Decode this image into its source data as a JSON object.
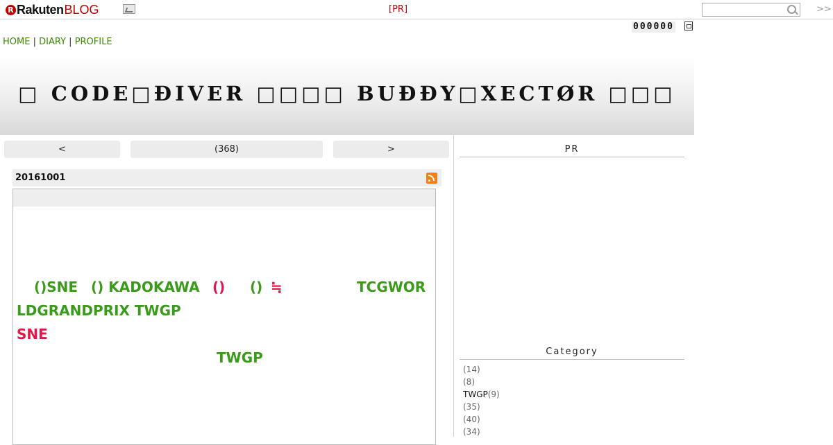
{
  "topbar": {
    "logo_text": "Rakuten",
    "logo_blog": "BLOG",
    "pr": "[PR]",
    "search": {
      "placeholder": ""
    },
    "more": ">>"
  },
  "counter": {
    "value": "000000"
  },
  "nav": {
    "home": "HOME",
    "diary": "DIARY",
    "profile": "PROFILE",
    "sep": "|"
  },
  "banner": {
    "title": "□ CODE□ĐIVER □□□□ BUĐĐY□XECTØR □□□"
  },
  "pager": {
    "prev": "<",
    "count": "(368)",
    "next": ">"
  },
  "entry": {
    "date": "20161001",
    "lines": [
      [
        "()SNE",
        "() KADOKAWA",
        "()",
        "()",
        "≒",
        "TCGWOR"
      ],
      [
        "LDGRANDPRIX TWGP"
      ],
      [
        "SNE"
      ],
      [
        "TWGP"
      ]
    ]
  },
  "sidebar": {
    "pr_heading": "PR",
    "category_heading": "Category",
    "categories": [
      {
        "name": "",
        "count": "(14)"
      },
      {
        "name": "",
        "count": "(8)"
      },
      {
        "name": "TWGP",
        "count": "(9)"
      },
      {
        "name": "",
        "count": "(35)"
      },
      {
        "name": "",
        "count": "(40)"
      },
      {
        "name": "",
        "count": "(34)"
      }
    ]
  },
  "colors": {
    "brand_red": "#bf0000",
    "link_green": "#3a8a00",
    "text_green": "#3a9a1a",
    "accent_red": "#e0194a"
  }
}
